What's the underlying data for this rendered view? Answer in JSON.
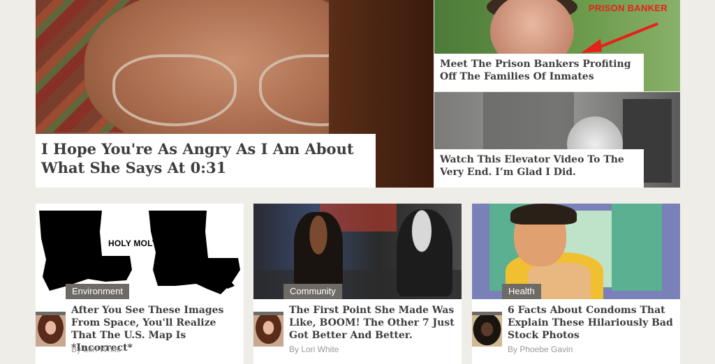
{
  "hero": {
    "title": "I Hope You're As Angry As I Am About What She Says At 0:31"
  },
  "side_stories": [
    {
      "title": "Meet The Prison Bankers Profiting Off The Families Of Inmates",
      "image_label": "PRISON BANKER"
    },
    {
      "title": "Watch This Elevator Video To The Very End. I’m Glad I Did."
    }
  ],
  "cards": [
    {
      "category": "Environment",
      "title": "After You See These Images From Space, You'll Realize That The U.S. Map Is *Incorrect*",
      "byline": "By Lori White",
      "image_text": "HOLY MOLY"
    },
    {
      "category": "Community",
      "title": "The First Point She Made Was Like, BOOM! The Other 7 Just Got Better And Better.",
      "byline": "By Lori White"
    },
    {
      "category": "Health",
      "title": "6 Facts About Condoms That Explain These Hilariously Bad Stock Photos",
      "byline": "By Phoebe Gavin"
    }
  ],
  "colors": {
    "background": "#efede8",
    "title_text": "#3d3d3d",
    "tag_bg": "#6e6a65",
    "byline": "#9a9a9a",
    "accent_red": "#e8201a"
  }
}
